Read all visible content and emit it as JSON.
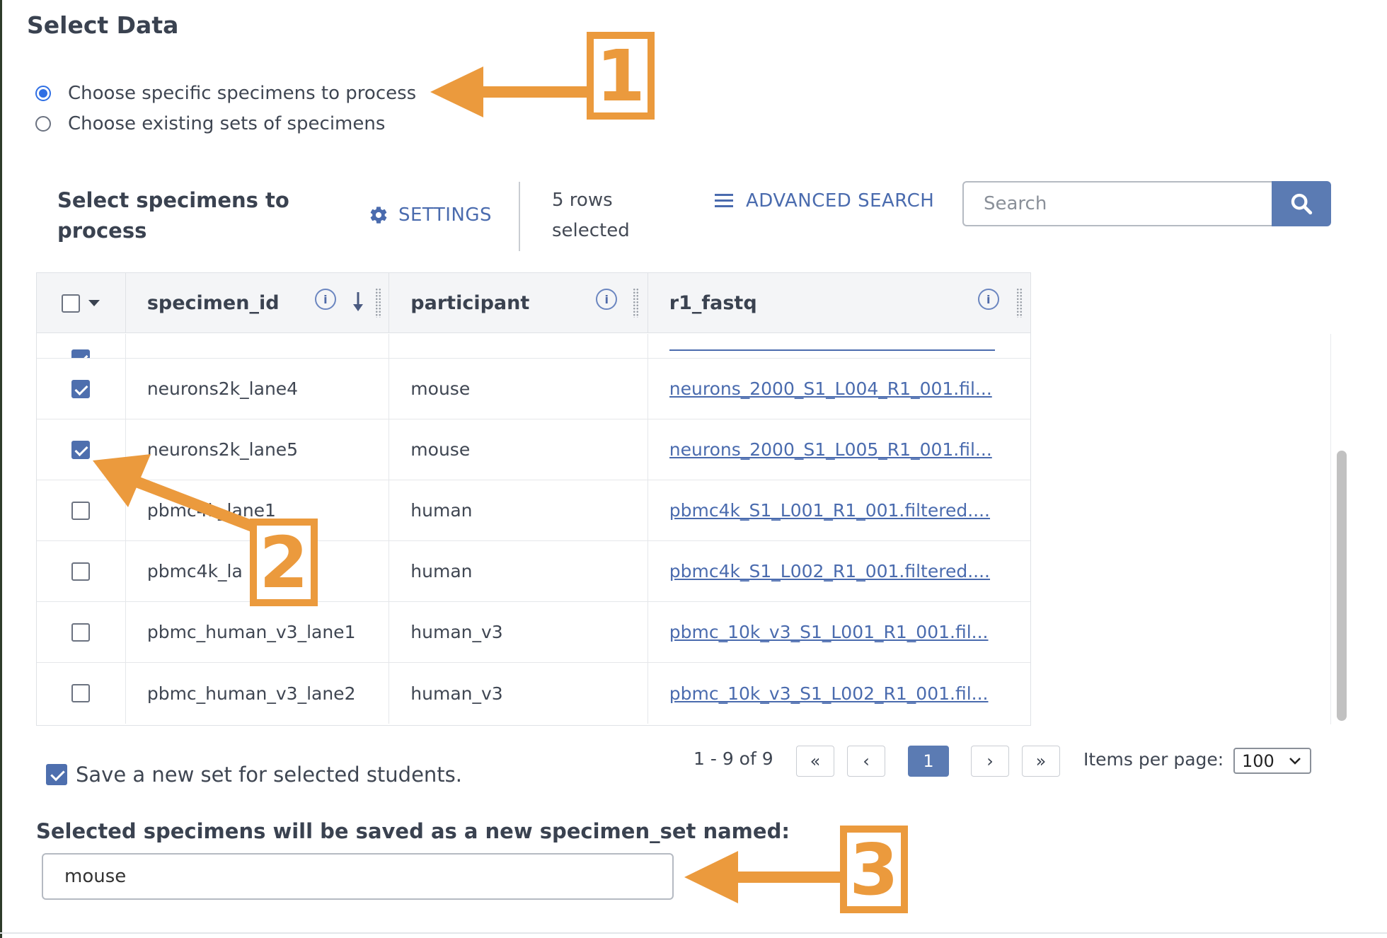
{
  "page": {
    "title": "Select Data"
  },
  "mode": {
    "options": [
      {
        "label": "Choose specific specimens to process",
        "selected": true
      },
      {
        "label": "Choose existing sets of specimens",
        "selected": false
      }
    ]
  },
  "toolbar": {
    "title": "Select specimens to process",
    "settings_label": "SETTINGS",
    "rows_selected": "5 rows selected",
    "advanced_search_label": "ADVANCED SEARCH",
    "search_placeholder": "Search"
  },
  "table": {
    "columns": [
      "specimen_id",
      "participant",
      "r1_fastq"
    ],
    "info_glyph": "i",
    "rows": [
      {
        "checked": true,
        "specimen_id": "neurons2k_lane4",
        "participant": "mouse",
        "r1_fastq": "neurons_2000_S1_L004_R1_001.fil..."
      },
      {
        "checked": true,
        "specimen_id": "neurons2k_lane5",
        "participant": "mouse",
        "r1_fastq": "neurons_2000_S1_L005_R1_001.fil..."
      },
      {
        "checked": false,
        "specimen_id": "pbmc4k_lane1",
        "participant": "human",
        "r1_fastq": "pbmc4k_S1_L001_R1_001.filtered...."
      },
      {
        "checked": false,
        "specimen_id": "pbmc4k_la",
        "participant": "human",
        "r1_fastq": "pbmc4k_S1_L002_R1_001.filtered...."
      },
      {
        "checked": false,
        "specimen_id": "pbmc_human_v3_lane1",
        "participant": "human_v3",
        "r1_fastq": "pbmc_10k_v3_S1_L001_R1_001.fil..."
      },
      {
        "checked": false,
        "specimen_id": "pbmc_human_v3_lane2",
        "participant": "human_v3",
        "r1_fastq": "pbmc_10k_v3_S1_L002_R1_001.fil..."
      }
    ],
    "sort_icon": "arrow-down-icon"
  },
  "pagination": {
    "range": "1 - 9 of 9",
    "first": "«",
    "prev": "‹",
    "current": "1",
    "next": "›",
    "last": "»",
    "items_per_page_label": "Items per page:",
    "items_per_page": "100"
  },
  "save_set": {
    "checked": true,
    "label": "Save a new set for selected students.",
    "name_label": "Selected specimens will be saved as a new specimen_set named:",
    "name_value": "mouse"
  },
  "callouts": [
    "1",
    "2",
    "3"
  ],
  "colors": {
    "accent": "#4a6bae",
    "button": "#5b7bb3",
    "callout": "#eb9a3d"
  }
}
